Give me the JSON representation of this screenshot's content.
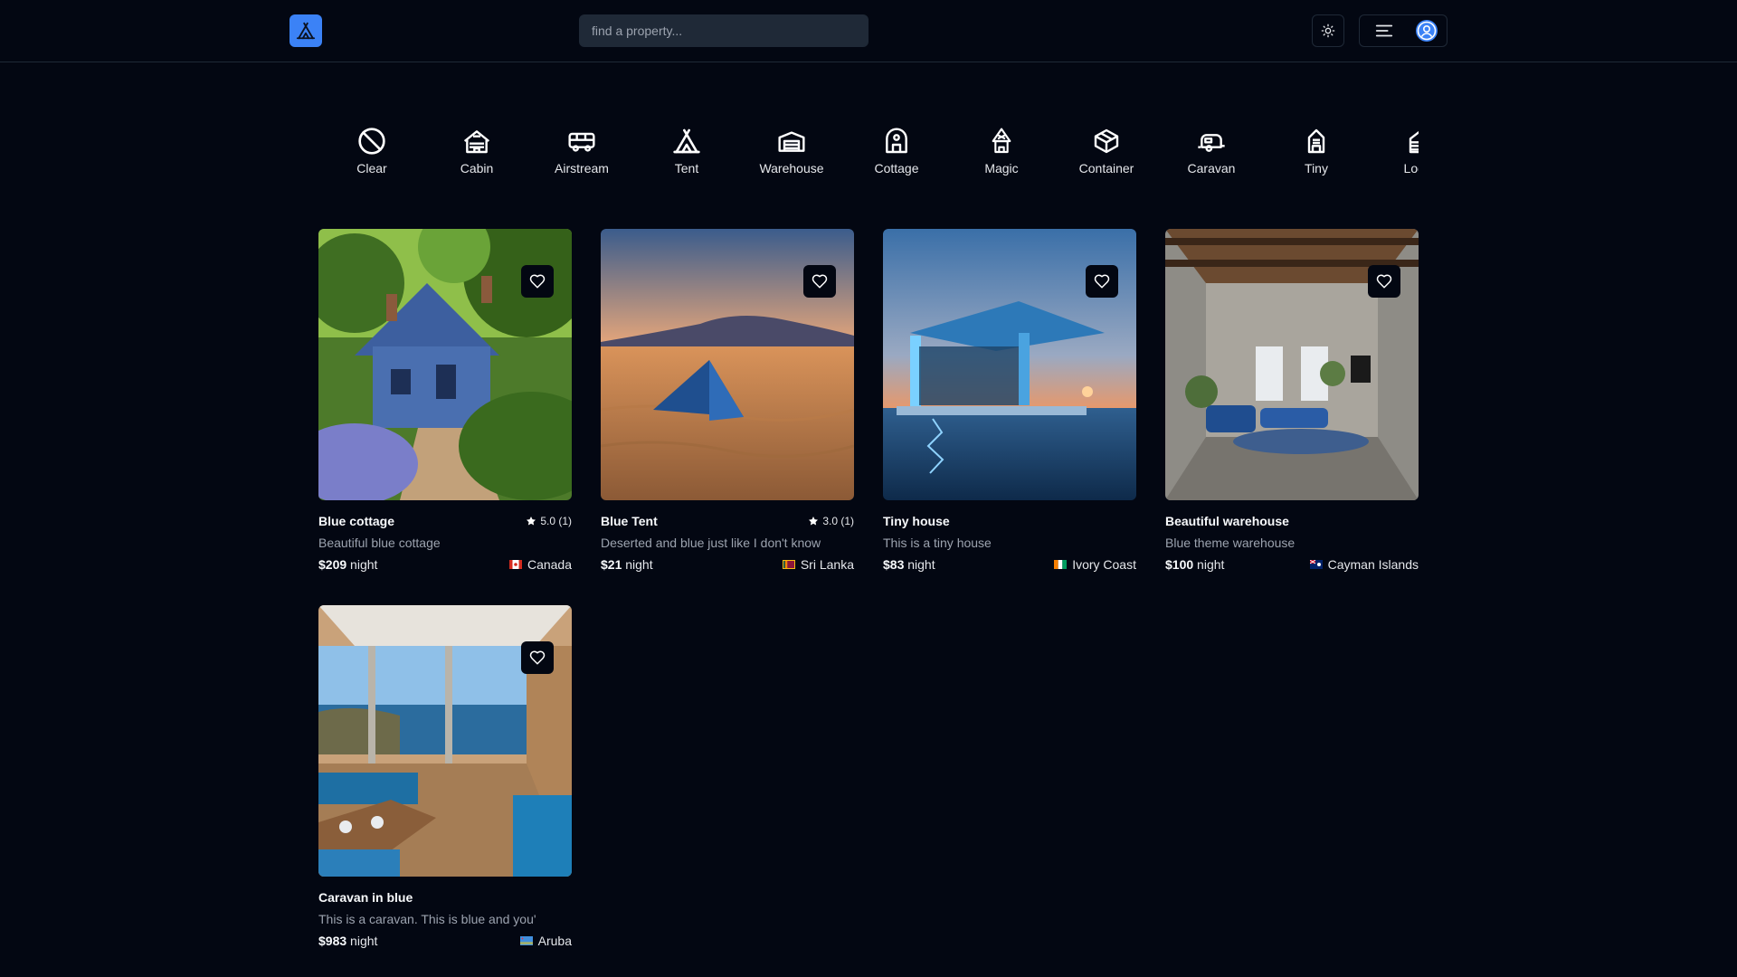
{
  "header": {
    "logo_icon": "tent-logo-icon",
    "search_placeholder": "find a property...",
    "theme_icon": "sun-icon",
    "menu_icon": "hamburger-icon",
    "user_icon": "user-avatar-icon"
  },
  "categories": [
    {
      "label": "Clear",
      "icon": "ban-icon"
    },
    {
      "label": "Cabin",
      "icon": "cabin-icon"
    },
    {
      "label": "Airstream",
      "icon": "bus-icon"
    },
    {
      "label": "Tent",
      "icon": "tent-icon"
    },
    {
      "label": "Warehouse",
      "icon": "warehouse-icon"
    },
    {
      "label": "Cottage",
      "icon": "cottage-icon"
    },
    {
      "label": "Magic",
      "icon": "magic-icon"
    },
    {
      "label": "Container",
      "icon": "box-icon"
    },
    {
      "label": "Caravan",
      "icon": "caravan-icon"
    },
    {
      "label": "Tiny",
      "icon": "tiny-icon"
    },
    {
      "label": "Lodge",
      "icon": "lodge-icon"
    }
  ],
  "properties": [
    {
      "title": "Blue cottage",
      "rating": "5.0 (1)",
      "description": "Beautiful blue cottage",
      "price": "$209",
      "unit": "night",
      "country": "Canada"
    },
    {
      "title": "Blue Tent",
      "rating": "3.0 (1)",
      "description": "Deserted and blue just like I don't know",
      "price": "$21",
      "unit": "night",
      "country": "Sri Lanka"
    },
    {
      "title": "Tiny house",
      "rating": "",
      "description": "This is a tiny house",
      "price": "$83",
      "unit": "night",
      "country": "Ivory Coast"
    },
    {
      "title": "Beautiful warehouse",
      "rating": "",
      "description": "Blue theme warehouse",
      "price": "$100",
      "unit": "night",
      "country": "Cayman Islands"
    },
    {
      "title": "Caravan in blue",
      "rating": "",
      "description": "This is a caravan. This is blue and you'",
      "price": "$983",
      "unit": "night",
      "country": "Aruba"
    }
  ],
  "colors": {
    "background": "#030712",
    "border": "#1f2937",
    "accent": "#3b82f6",
    "muted_text": "#9ca3af"
  }
}
